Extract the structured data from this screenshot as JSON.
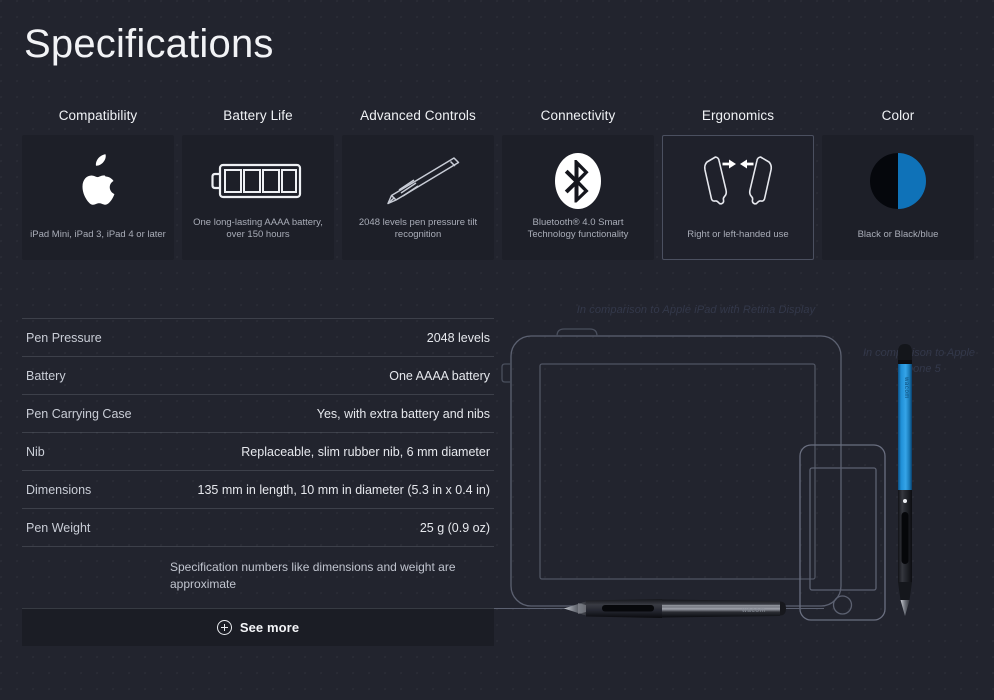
{
  "page": {
    "title": "Specifications",
    "background_color": "#22242e",
    "accent_blue": "#1f8fd6",
    "card_bg": "#1d1f28"
  },
  "feature_cards": [
    {
      "title": "Compatibility",
      "icon": "apple-logo-icon",
      "caption": "iPad Mini, iPad 3, iPad 4 or later",
      "hovered": false
    },
    {
      "title": "Battery Life",
      "icon": "battery-icon",
      "caption": "One long-lasting AAAA battery, over 150 hours",
      "hovered": false
    },
    {
      "title": "Advanced Controls",
      "icon": "stylus-pen-icon",
      "caption": "2048 levels pen pressure tilt recognition",
      "hovered": false
    },
    {
      "title": "Connectivity",
      "icon": "bluetooth-icon",
      "caption": "Bluetooth® 4.0 Smart Technology functionality",
      "hovered": false
    },
    {
      "title": "Ergonomics",
      "icon": "left-right-hand-pen-icon",
      "caption": "Right or left-handed use",
      "hovered": true
    },
    {
      "title": "Color",
      "icon": "color-swatch-split-circle-icon",
      "caption": "Black or Black/blue",
      "hovered": false
    }
  ],
  "spec_table": {
    "rows": [
      {
        "key": "Pen Pressure",
        "value": "2048 levels"
      },
      {
        "key": "Battery",
        "value": "One AAAA battery"
      },
      {
        "key": "Pen Carrying Case",
        "value": "Yes, with extra battery and nibs"
      },
      {
        "key": "Nib",
        "value": "Replaceable, slim rubber nib, 6 mm diameter"
      },
      {
        "key": "Dimensions",
        "value": "135 mm in length, 10 mm in diameter (5.3 in x 0.4 in)"
      },
      {
        "key": "Pen Weight",
        "value": "25 g (0.9 oz)"
      }
    ],
    "note": "Specification numbers like dimensions and weight are approximate",
    "see_more_label": "See more",
    "see_more_icon": "plus-circle-icon"
  },
  "illustration": {
    "caption_top": "In comparison to Apple iPad with Retina Display",
    "caption_right": "In comparison to Apple iPhone 5",
    "devices": [
      "ipad-outline",
      "iphone-outline"
    ],
    "pens": [
      "black-pen-horizontal",
      "blue-pen-vertical"
    ],
    "pen_brand": "wacom"
  }
}
